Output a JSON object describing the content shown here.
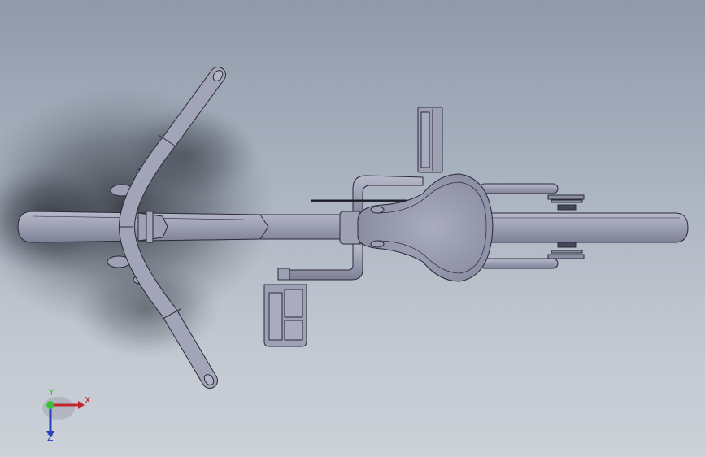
{
  "viewport": {
    "background_top": "#8f9aaa",
    "background_bottom": "#ccd1d8",
    "part_color": "#9ea0b4",
    "edge_color": "#2a2a36"
  },
  "model_parts": [
    "shadow",
    "main-tube",
    "handlebar",
    "stem",
    "brake-lever-left",
    "brake-lever-right",
    "saddle",
    "seat-stay-upper",
    "seat-stay-lower",
    "crank-arm-upper",
    "crank-arm-lower",
    "pedal-upper",
    "pedal-lower",
    "rear-tube",
    "cassette-upper",
    "cassette-lower",
    "chain-blade"
  ],
  "triad": {
    "x_label": "X",
    "y_label": "Y",
    "z_label": "Z",
    "x_color": "#c0262c",
    "y_color": "#3cbf3c",
    "z_color": "#2a3fbf"
  }
}
